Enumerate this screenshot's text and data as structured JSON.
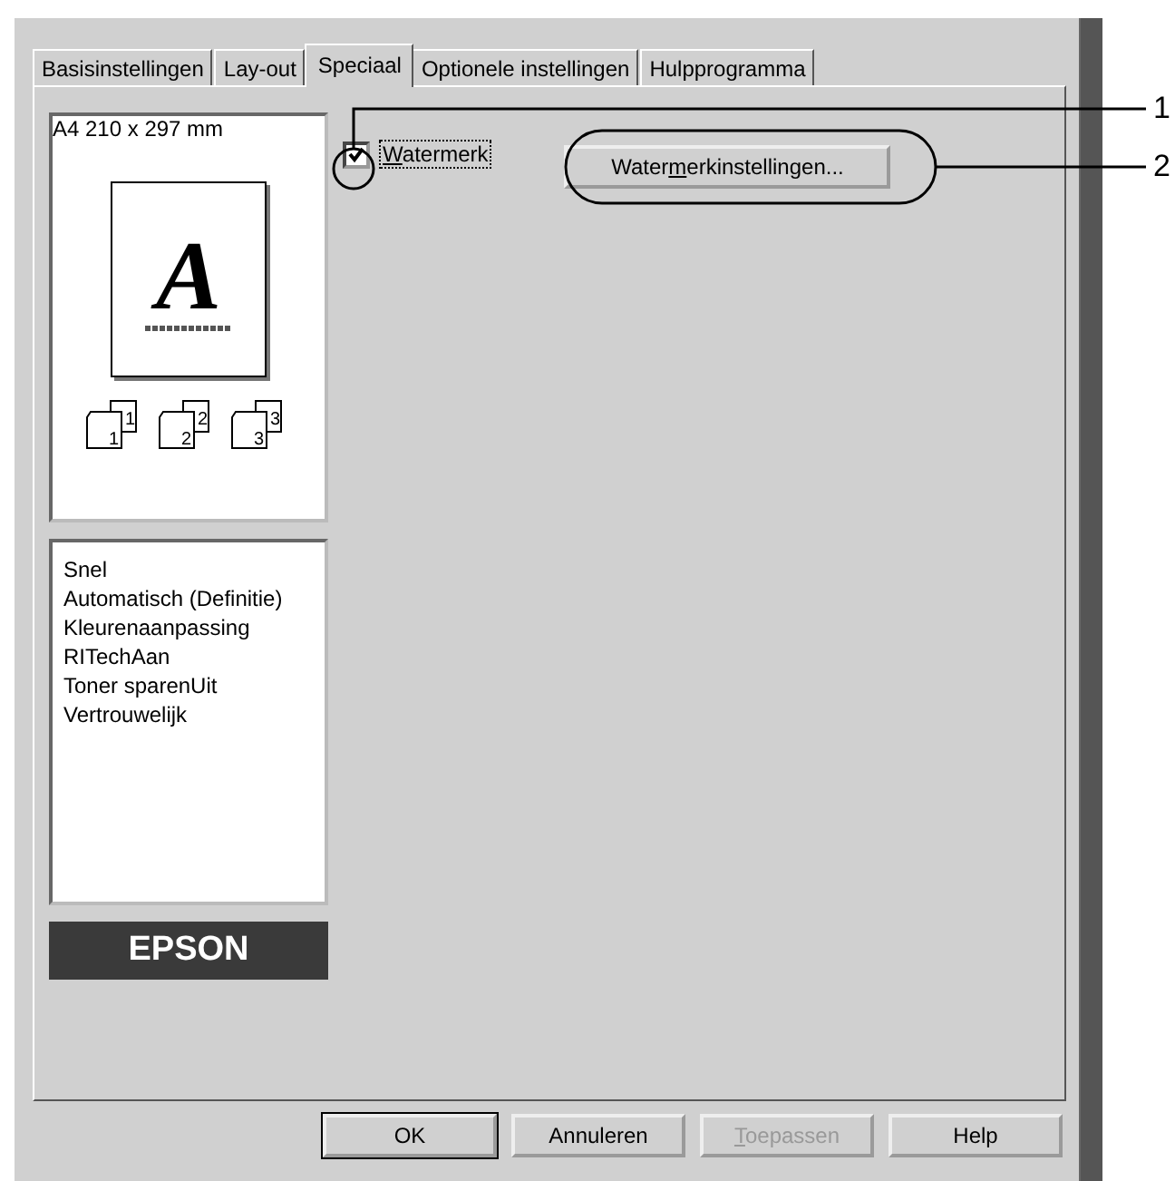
{
  "tabs": [
    {
      "label": "Basisinstellingen",
      "selected": false
    },
    {
      "label": "Lay-out",
      "selected": false
    },
    {
      "label": "Speciaal",
      "selected": true
    },
    {
      "label": "Optionele instellingen",
      "selected": false
    },
    {
      "label": "Hulpprogramma",
      "selected": false
    }
  ],
  "preview": {
    "paper": "A4 210 x 297 mm",
    "letter": "A",
    "copy_icons": [
      {
        "front": "1",
        "back": "1"
      },
      {
        "front": "2",
        "back": "2"
      },
      {
        "front": "3",
        "back": "3"
      }
    ]
  },
  "settings_list": [
    "Snel",
    "Automatisch (Definitie)",
    "Kleurenaanpassing",
    "RITechAan",
    "Toner sparenUit",
    "Vertrouwelijk"
  ],
  "logo": "EPSON",
  "watermark": {
    "mnemonic": "W",
    "label_rest": "atermerk",
    "checked": true
  },
  "watermark_settings_button": {
    "label": "Water",
    "mnemonic": "m",
    "label_rest": "erkinstellingen..."
  },
  "buttons": [
    {
      "label": "OK",
      "disabled": false,
      "default": true
    },
    {
      "label": "Annuleren",
      "disabled": false,
      "default": false
    },
    {
      "mnemonic": "T",
      "label_rest": "oepassen",
      "disabled": true,
      "default": false
    },
    {
      "label": "Help",
      "disabled": false,
      "default": false
    }
  ],
  "callouts": [
    "1",
    "2"
  ]
}
